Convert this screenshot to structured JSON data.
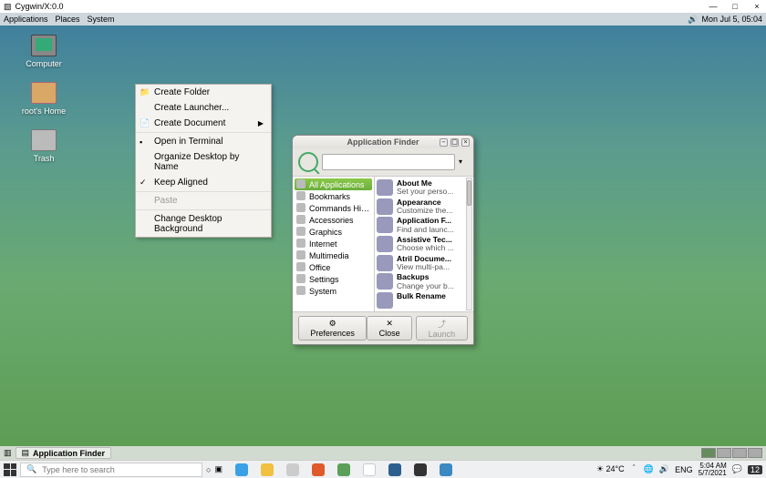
{
  "os_titlebar": {
    "title": "Cygwin/X:0.0",
    "min": "—",
    "max": "□",
    "close": "×"
  },
  "mate_panel": {
    "menus": [
      "Applications",
      "Places",
      "System"
    ],
    "clock_icon": "🔊",
    "clock": "Mon Jul  5, 05:04"
  },
  "desktop_icons": [
    {
      "label": "Computer"
    },
    {
      "label": "root's Home"
    },
    {
      "label": "Trash"
    }
  ],
  "context_menu": [
    {
      "label": "Create Folder",
      "glyph": "📁"
    },
    {
      "label": "Create Launcher...",
      "glyph": ""
    },
    {
      "label": "Create Document",
      "glyph": "📄",
      "submenu": true
    },
    {
      "sep": true
    },
    {
      "label": "Open in Terminal",
      "glyph": "▪"
    },
    {
      "label": "Organize Desktop by Name",
      "glyph": ""
    },
    {
      "label": "Keep Aligned",
      "glyph": "✓"
    },
    {
      "sep": true
    },
    {
      "label": "Paste",
      "glyph": "",
      "disabled": true
    },
    {
      "sep": true
    },
    {
      "label": "Change Desktop Background",
      "glyph": ""
    }
  ],
  "appfinder": {
    "title": "Application Finder",
    "search_value": "",
    "categories": [
      {
        "label": "All Applications",
        "selected": true
      },
      {
        "label": "Bookmarks"
      },
      {
        "label": "Commands His..."
      },
      {
        "label": "Accessories"
      },
      {
        "label": "Graphics"
      },
      {
        "label": "Internet"
      },
      {
        "label": "Multimedia"
      },
      {
        "label": "Office"
      },
      {
        "label": "Settings"
      },
      {
        "label": "System"
      }
    ],
    "apps": [
      {
        "title": "About Me",
        "sub": "Set your perso..."
      },
      {
        "title": "Appearance",
        "sub": "Customize the..."
      },
      {
        "title": "Application F...",
        "sub": "Find and launc..."
      },
      {
        "title": "Assistive Tec...",
        "sub": "Choose which ..."
      },
      {
        "title": "Atril Docume...",
        "sub": "View multi-pa..."
      },
      {
        "title": "Backups",
        "sub": "Change your b..."
      },
      {
        "title": "Bulk Rename",
        "sub": ""
      }
    ],
    "footer": {
      "prefs": "Preferences",
      "close": "Close",
      "launch": "Launch"
    }
  },
  "mate_bottom": {
    "task": "Application Finder"
  },
  "win_taskbar": {
    "search_placeholder": "Type here to search",
    "weather": "24°C",
    "tray": {
      "lang": "ENG",
      "time": "5:04 AM",
      "date": "5/7/2021"
    },
    "notif": "12"
  }
}
